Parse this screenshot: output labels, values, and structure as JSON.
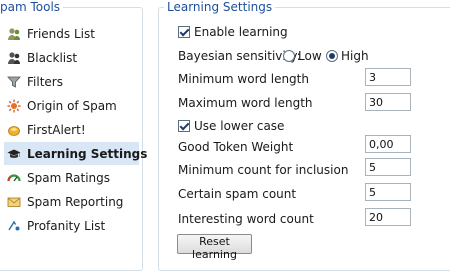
{
  "spam_tools": {
    "title": "pam Tools",
    "items": [
      {
        "label": "Friends List",
        "icon": "friends-icon"
      },
      {
        "label": "Blacklist",
        "icon": "blacklist-icon"
      },
      {
        "label": "Filters",
        "icon": "filter-funnel-icon"
      },
      {
        "label": "Origin of Spam",
        "icon": "origin-burst-icon"
      },
      {
        "label": "FirstAlert!",
        "icon": "first-alert-icon"
      },
      {
        "label": "Learning Settings",
        "icon": "graduation-cap-icon",
        "selected": true
      },
      {
        "label": "Spam Ratings",
        "icon": "rating-gauge-icon"
      },
      {
        "label": "Spam Reporting",
        "icon": "report-envelope-icon"
      },
      {
        "label": "Profanity List",
        "icon": "profanity-icon"
      }
    ]
  },
  "learning_settings": {
    "title": "Learning Settings",
    "enable_learning": {
      "label": "Enable learning",
      "checked": true
    },
    "bayesian_sensitivity": {
      "label": "Bayesian sensitivity:",
      "options": [
        "Low",
        "High"
      ],
      "selected": "High"
    },
    "minimum_word_length": {
      "label": "Minimum word length",
      "value": "3"
    },
    "maximum_word_length": {
      "label": "Maximum word length",
      "value": "30"
    },
    "use_lower_case": {
      "label": "Use lower case",
      "checked": true
    },
    "good_token_weight": {
      "label": "Good Token Weight",
      "value": "0,00"
    },
    "minimum_count_for_inclusion": {
      "label": "Minimum count for inclusion",
      "value": "5"
    },
    "certain_spam_count": {
      "label": "Certain spam count",
      "value": "5"
    },
    "interesting_word_count": {
      "label": "Interesting word count",
      "value": "20"
    },
    "reset_button": "Reset learning"
  },
  "colors": {
    "group_title": "#1e4f9c",
    "selected_background": "#d9e6f5",
    "group_border": "#d5dfe5"
  }
}
